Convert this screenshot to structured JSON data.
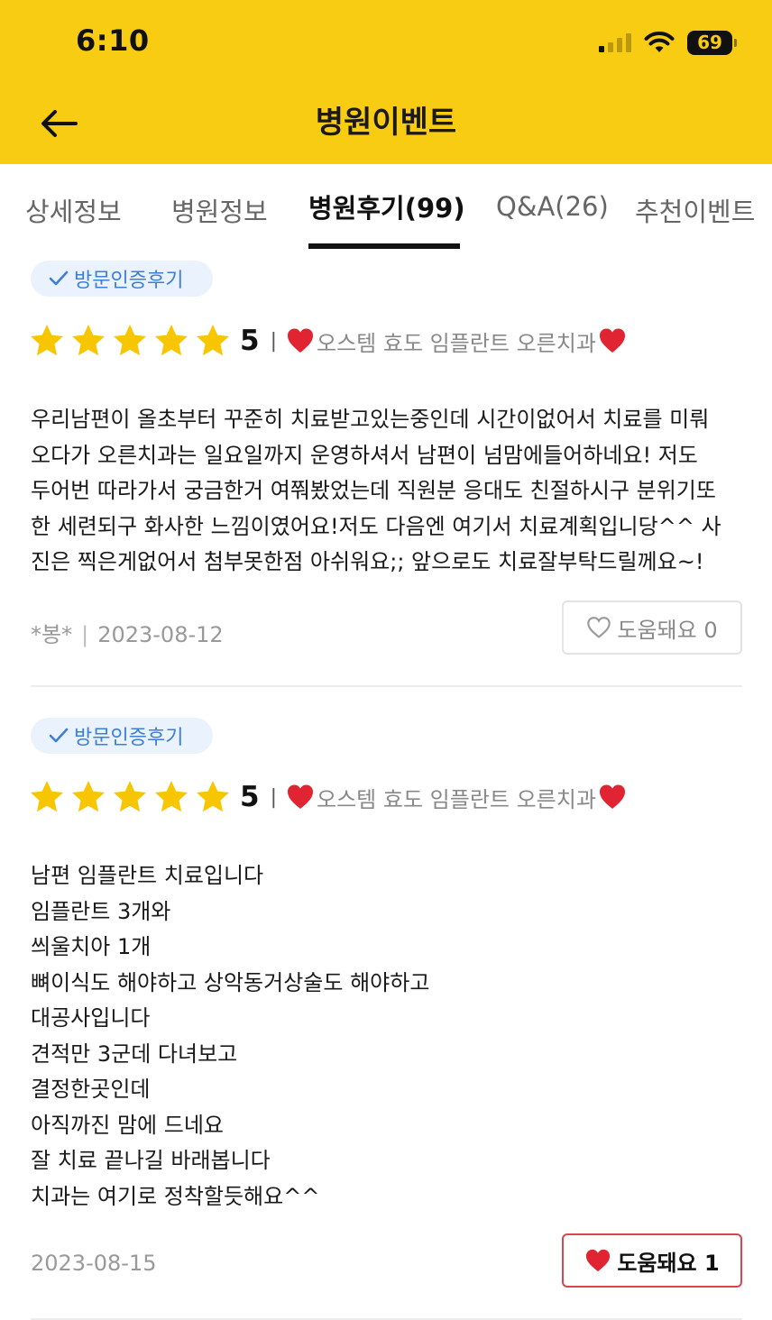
{
  "status": {
    "time": "6:10",
    "battery": "69"
  },
  "header": {
    "title": "병원이벤트",
    "back_icon": "back-arrow-icon"
  },
  "tabs": [
    {
      "label": "상세정보"
    },
    {
      "label": "병원정보"
    },
    {
      "label": "병원후기(99)",
      "active": true
    },
    {
      "label": "Q&A(26)"
    },
    {
      "label": "추천이벤트"
    }
  ],
  "colors": {
    "brand": "#f9cc14",
    "star": "#f7c600",
    "heart": "#e02431",
    "badge_text": "#3d7fd6"
  },
  "reviews": [
    {
      "badge": "방문인증후기",
      "stars": 5,
      "score": "5",
      "separator": "|",
      "hospital": "오스템 효도 임플란트 오른치과",
      "text": "우리남편이 올초부터 꾸준히 치료받고있는중인데 시간이없어서 치료를 미뤄\n오다가 오른치과는 일요일까지 운영하셔서 남편이 넘맘에들어하네요! 저도\n두어번 따라가서 궁금한거 여쭤봤었는데 직원분 응대도 친절하시구 분위기또\n한 세련되구 화사한 느낌이였어요!저도 다음엔 여기서 치료계획입니당^^ 사\n진은 찍은게없어서 첨부못한점 아쉬워요;; 앞으로도 치료잘부탁드릴께요~!",
      "author": "*봉*",
      "meta_sep": "|",
      "date": "2023-08-12",
      "help_label": "도움돼요 0",
      "help_active": false
    },
    {
      "badge": "방문인증후기",
      "stars": 5,
      "score": "5",
      "separator": "|",
      "hospital": "오스템 효도 임플란트 오른치과",
      "text": "남편 임플란트 치료입니다\n임플란트 3개와\n씌울치아 1개\n뼈이식도 해야하고 상악동거상술도 해야하고\n대공사입니다\n견적만 3군데 다녀보고\n결정한곳인데\n아직까진 맘에 드네요\n잘 치료 끝나길 바래봅니다\n치과는 여기로 정착할듯해요^^",
      "date": "2023-08-15",
      "help_label": "도움돼요 1",
      "help_active": true
    }
  ]
}
